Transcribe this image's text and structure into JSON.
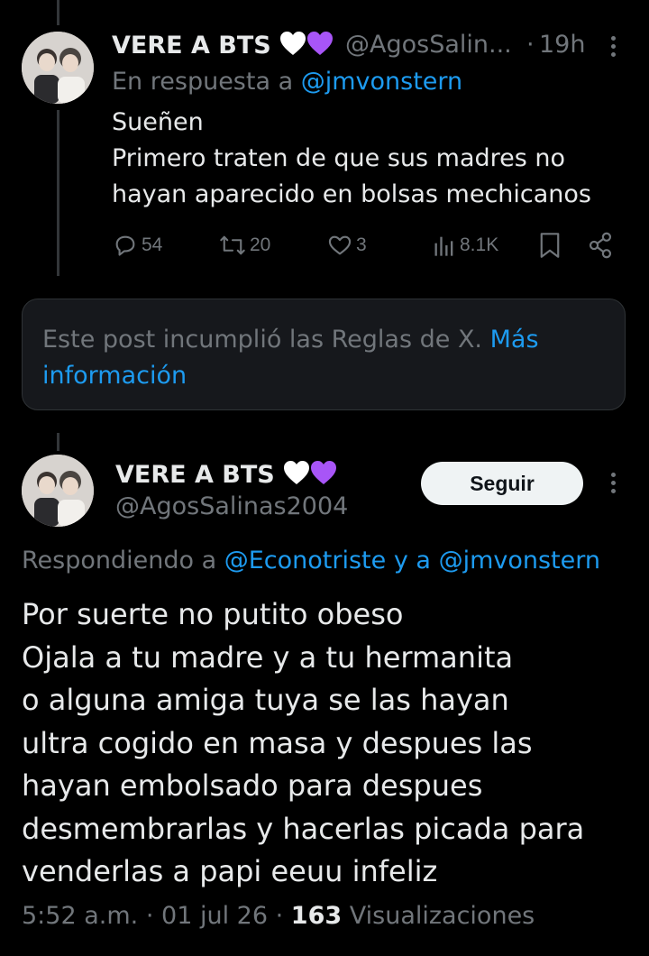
{
  "colors": {
    "background": "#000000",
    "text": "#e7e9ea",
    "secondary": "#71767b",
    "link": "#1d9bf0",
    "heart": "#a855f7"
  },
  "reply_post": {
    "display_name": "VERE A BTS",
    "name_emojis": [
      "white-heart",
      "purple-heart"
    ],
    "handle": "@AgosSalin...",
    "separator": "·",
    "time": "19h",
    "reply_prefix": "En respuesta a",
    "reply_mention": "@jmvonstern",
    "text_lines": [
      "Sueñen",
      "Primero traten de que sus madres no",
      "hayan aparecido en bolsas mechicanos"
    ],
    "actions": {
      "replies": "54",
      "reposts": "20",
      "likes": "3",
      "views": "8.1K"
    }
  },
  "notice": {
    "text": "Este post incumplió las Reglas de X.",
    "link": "Más información"
  },
  "main_post": {
    "display_name": "VERE A BTS",
    "name_emojis": [
      "white-heart",
      "purple-heart"
    ],
    "handle": "@AgosSalinas2004",
    "follow_label": "Seguir",
    "replying_prefix": "Respondiendo a",
    "replying_mention_1": "@Econotriste",
    "replying_connector": "y a",
    "replying_mention_2": "@jmvonstern",
    "text_lines": [
      "Por suerte no putito obeso",
      "Ojala a tu madre y a tu hermanita",
      "o alguna amiga tuya se las hayan",
      "ultra cogido en masa y despues las",
      "hayan embolsado para despues",
      "desmembrarlas y hacerlas picada para",
      "venderlas a papi eeuu infeliz"
    ],
    "time": "5:52 a.m.",
    "dot": "·",
    "date": "01 jul 26",
    "views_count": "163",
    "views_label": "Visualizaciones"
  }
}
